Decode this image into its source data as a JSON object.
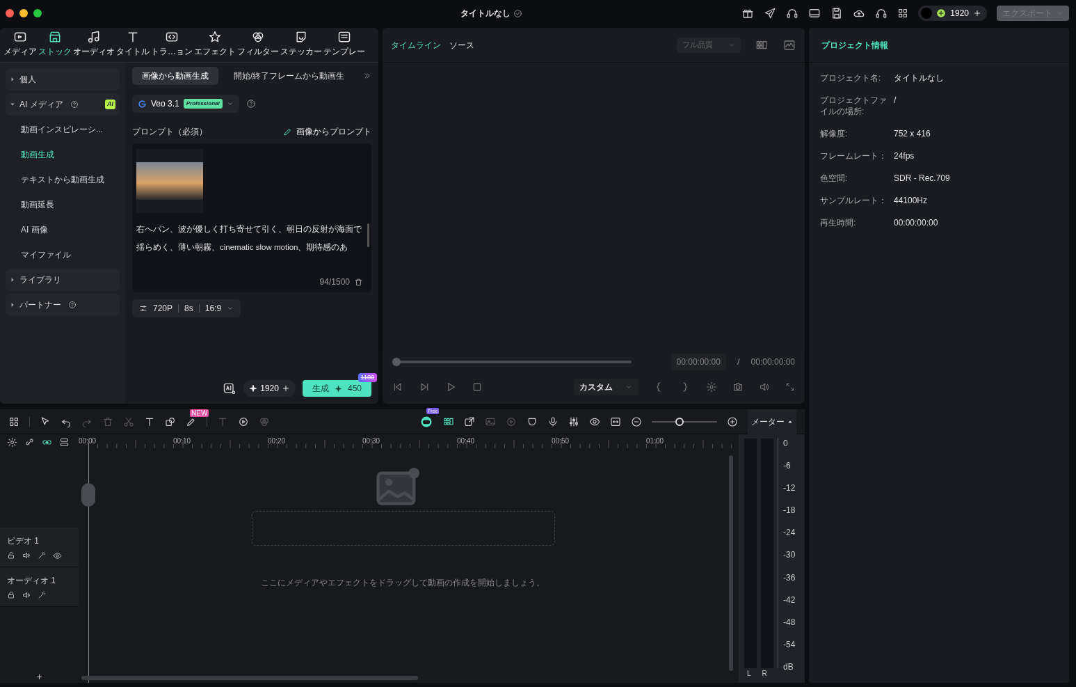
{
  "window": {
    "title": "タイトルなし",
    "credits": "1920",
    "export": "エクスポート"
  },
  "media_tabs": [
    {
      "label": "メディア",
      "kind": "media",
      "selected": false
    },
    {
      "label": "ストック",
      "kind": "stock",
      "selected": true
    },
    {
      "label": "オーディオ",
      "kind": "audio",
      "selected": false
    },
    {
      "label": "タイトル",
      "kind": "title",
      "selected": false
    },
    {
      "label": "トラ…ョン",
      "kind": "transition",
      "selected": false
    },
    {
      "label": "エフェクト",
      "kind": "effect",
      "selected": false
    },
    {
      "label": "フィルター",
      "kind": "filter",
      "selected": false
    },
    {
      "label": "ステッカー",
      "kind": "sticker",
      "selected": false
    },
    {
      "label": "テンプレー",
      "kind": "template",
      "selected": false
    }
  ],
  "sidebar": [
    {
      "label": "個人",
      "expanded": false,
      "help": false
    },
    {
      "label": "AI メディア",
      "expanded": true,
      "help": true,
      "badge": "AI",
      "children": [
        {
          "label": "動画インスピレーシ...",
          "selected": false
        },
        {
          "label": "動画生成",
          "selected": true
        },
        {
          "label": "テキストから動画生成",
          "selected": false
        },
        {
          "label": "動画延長",
          "selected": false
        },
        {
          "label": "AI 画像",
          "selected": false
        },
        {
          "label": "マイファイル",
          "selected": false
        }
      ]
    },
    {
      "label": "ライブラリ",
      "expanded": false,
      "help": false
    },
    {
      "label": "パートナー",
      "expanded": false,
      "help": true
    }
  ],
  "generator": {
    "tabs": [
      {
        "label": "画像から動画生成",
        "selected": true
      },
      {
        "label": "開始/終了フレームから動画生",
        "selected": false
      }
    ],
    "model": "Veo 3.1",
    "model_badge": "Professional",
    "prompt_label": "プロンプト（必須）",
    "image_to_prompt": "画像からプロンプト",
    "prompt_lines": [
      "右へパン、波が優しく打ち寄せて引く、朝日の反射が海面で",
      "揺らめく、薄い朝霧、cinematic slow motion、期待感のあ"
    ],
    "counter": "94/1500",
    "settings": [
      "720P",
      "8s",
      "16:9"
    ],
    "credits": "1920",
    "generate": "生成",
    "cost": "450",
    "old_cost": "1100"
  },
  "preview": {
    "tabs": [
      {
        "label": "タイムライン",
        "selected": true
      },
      {
        "label": "ソース",
        "selected": false
      }
    ],
    "quality": "フル品質",
    "progress": {
      "level": 0
    },
    "current_time": "00:00:00:00",
    "separator": "/",
    "total_time": "00:00:00:00",
    "zoom": "カスタム"
  },
  "project_info": {
    "title": "プロジェクト情報",
    "rows": [
      {
        "label": "プロジェクト名:",
        "value": "タイトルなし"
      },
      {
        "label": "プロジェクトファイルの場所:",
        "value": "/"
      },
      {
        "label": "解像度:",
        "value": "752 x 416"
      },
      {
        "label": "フレームレート：",
        "value": "24fps"
      },
      {
        "label": "色空間:",
        "value": "SDR - Rec.709"
      },
      {
        "label": "サンプルレート：",
        "value": "44100Hz"
      },
      {
        "label": "再生時間:",
        "value": "00:00:00:00"
      }
    ]
  },
  "timeline": {
    "new_badge": "NEW",
    "free_badge": "Free",
    "zoom": {
      "level": 0.41
    },
    "meter_title": "メーター",
    "ruler": [
      "00:00",
      "00:10",
      "00:20",
      "00:30",
      "00:40",
      "00:50",
      "01:00"
    ],
    "tracks": [
      {
        "label": "ビデオ 1",
        "kind": "video"
      },
      {
        "label": "オーディオ 1",
        "kind": "audio"
      }
    ],
    "drop_hint": "ここにメディアやエフェクトをドラッグして動画の作成を開始しましょう。",
    "add_track": "+",
    "meter_scale": [
      "0",
      "-6",
      "-12",
      "-18",
      "-24",
      "-30",
      "-36",
      "-42",
      "-48",
      "-54",
      "dB"
    ],
    "channels": [
      "L",
      "R"
    ]
  }
}
